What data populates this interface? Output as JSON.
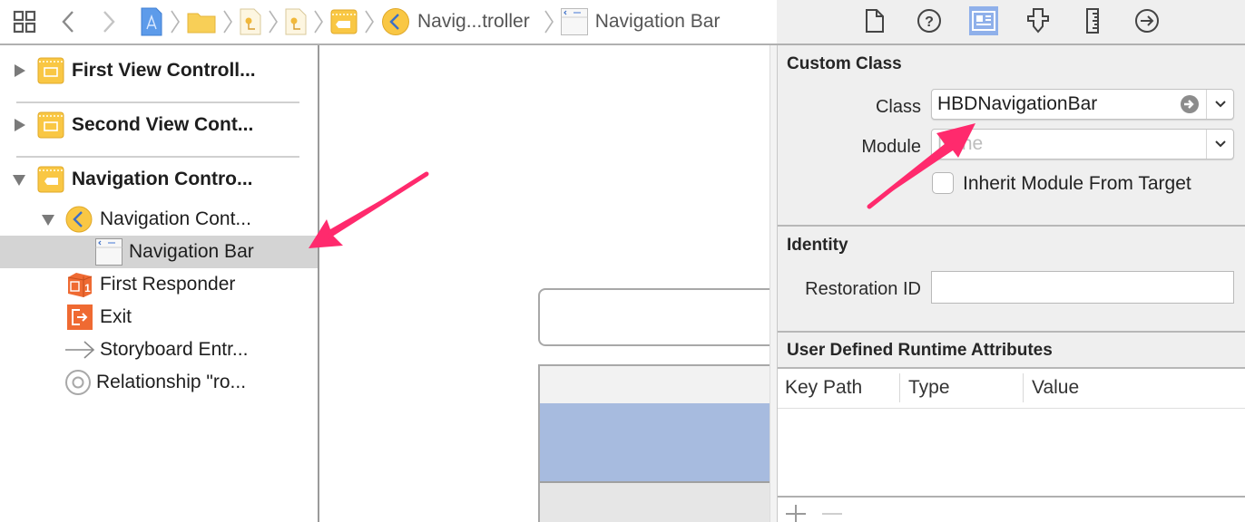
{
  "jumpbar": {
    "nav_back_label": "Back",
    "nav_forward_label": "Forward",
    "related_items_icon": "grid-icon",
    "breadcrumbs": [
      {
        "icon": "xcode-project-icon",
        "label": ""
      },
      {
        "icon": "folder-icon",
        "label": ""
      },
      {
        "icon": "storyboard-file-icon",
        "label": ""
      },
      {
        "icon": "storyboard-file-icon",
        "label": ""
      },
      {
        "icon": "scene-icon",
        "label": ""
      },
      {
        "icon": "navigation-controller-icon",
        "label": "Navig...troller"
      },
      {
        "icon": "navigation-bar-icon",
        "label": "Navigation Bar"
      }
    ]
  },
  "inspector_tabs": [
    {
      "name": "file-inspector",
      "icon": "document-icon",
      "active": false
    },
    {
      "name": "quick-help-inspector",
      "icon": "question-icon",
      "active": false
    },
    {
      "name": "identity-inspector",
      "icon": "identity-card-icon",
      "active": true
    },
    {
      "name": "attributes-inspector",
      "icon": "attributes-slider-icon",
      "active": false
    },
    {
      "name": "size-inspector",
      "icon": "ruler-icon",
      "active": false
    },
    {
      "name": "connections-inspector",
      "icon": "arrow-circle-icon",
      "active": false
    }
  ],
  "outline": {
    "items": [
      {
        "label": "First View Controll...",
        "bold": true,
        "disclosure": "collapsed",
        "icon": "view-controller-scene-icon"
      },
      {
        "label": "Second View Cont...",
        "bold": true,
        "disclosure": "collapsed",
        "icon": "view-controller-scene-icon"
      },
      {
        "label": "Navigation Contro...",
        "bold": true,
        "disclosure": "expanded",
        "icon": "navigation-controller-scene-icon"
      },
      {
        "label": "Navigation Cont...",
        "bold": false,
        "disclosure": "expanded",
        "icon": "navigation-controller-icon"
      },
      {
        "label": "Navigation Bar",
        "bold": false,
        "disclosure": "none",
        "icon": "navigation-bar-icon",
        "selected": true
      },
      {
        "label": "First Responder",
        "bold": false,
        "disclosure": "none",
        "icon": "first-responder-icon"
      },
      {
        "label": "Exit",
        "bold": false,
        "disclosure": "none",
        "icon": "exit-icon"
      },
      {
        "label": "Storyboard Entr...",
        "bold": false,
        "disclosure": "none",
        "icon": "entry-arrow-icon"
      },
      {
        "label": "Relationship \"ro...",
        "bold": false,
        "disclosure": "none",
        "icon": "relationship-icon"
      }
    ]
  },
  "inspector": {
    "custom_class": {
      "title": "Custom Class",
      "class_label": "Class",
      "class_value": "HBDNavigationBar",
      "module_label": "Module",
      "module_placeholder": "None",
      "module_value": "",
      "inherit_label": "Inherit Module From Target",
      "inherit_checked": false
    },
    "identity": {
      "title": "Identity",
      "restoration_id_label": "Restoration ID",
      "restoration_id_value": ""
    },
    "runtime_attributes": {
      "title": "User Defined Runtime Attributes",
      "columns": [
        "Key Path",
        "Type",
        "Value"
      ],
      "rows": [],
      "add_label": "+",
      "remove_label": "−"
    }
  },
  "colors": {
    "annotation_arrow": "#ff2a6d",
    "selection_row": "#d4d4d4",
    "active_tab": "#8fb0ea",
    "scene_icon_yellow": "#f9c744",
    "responder_orange": "#ef6a32",
    "nav_bar_fill": "#a7bbdf"
  }
}
